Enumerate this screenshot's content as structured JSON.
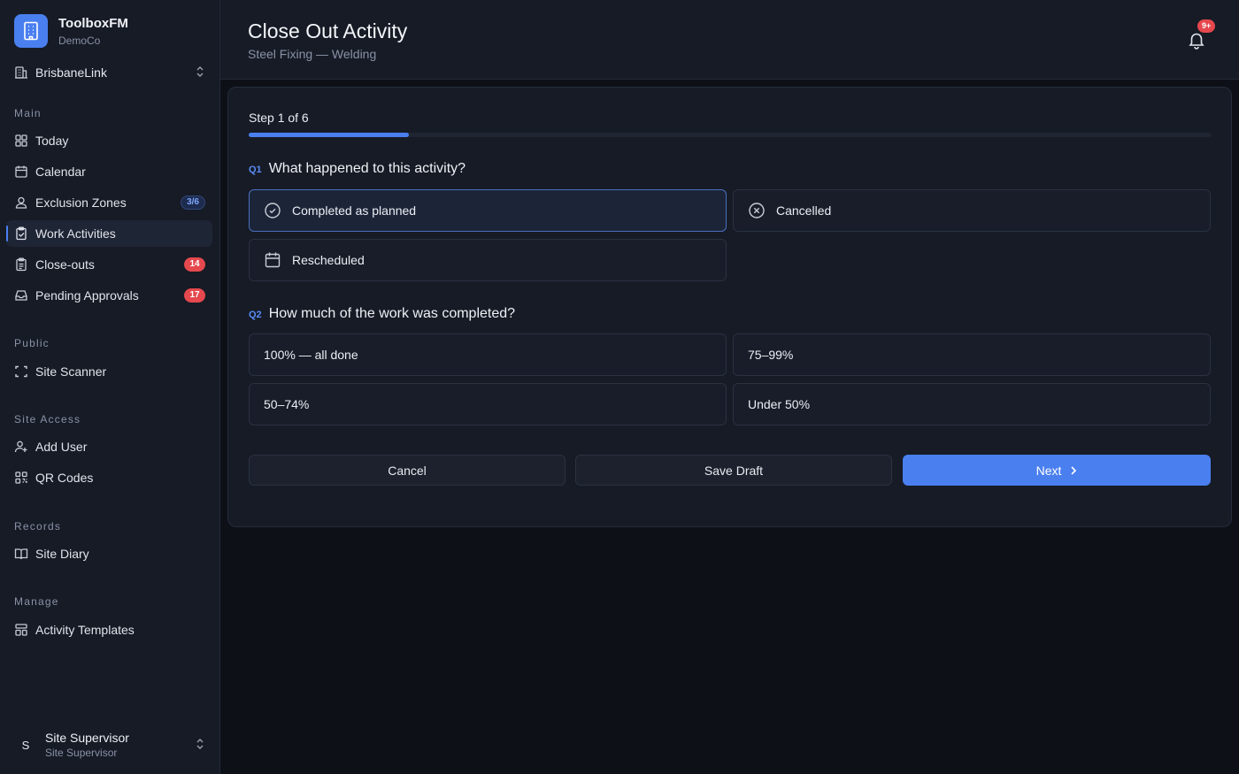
{
  "brand": {
    "name": "ToolboxFM",
    "org": "DemoCo"
  },
  "site": {
    "selected": "BrisbaneLink"
  },
  "sidebar": {
    "sections": {
      "main": "Main",
      "public": "Public",
      "site_access": "Site Access",
      "records": "Records",
      "manage": "Manage"
    },
    "items": {
      "today": "Today",
      "calendar": "Calendar",
      "exclusion_zones": "Exclusion Zones",
      "exclusion_badge": "3/6",
      "work_activities": "Work Activities",
      "close_outs": "Close-outs",
      "close_outs_badge": "14",
      "pending_approvals": "Pending Approvals",
      "pending_badge": "17",
      "site_scanner": "Site Scanner",
      "add_user": "Add User",
      "qr_codes": "QR Codes",
      "site_diary": "Site Diary",
      "activity_templates": "Activity Templates"
    },
    "active_item": "Work Activities"
  },
  "user": {
    "initial": "S",
    "name": "Site Supervisor",
    "role": "Site Supervisor"
  },
  "header": {
    "title": "Close Out Activity",
    "subtitle": "Steel Fixing — Welding",
    "notification_badge": "9+"
  },
  "wizard": {
    "step_label": "Step 1 of 6",
    "progress": 0.1667,
    "q1": {
      "num": "Q1",
      "text": "What happened to this activity?",
      "options": [
        "Completed as planned",
        "Cancelled",
        "Rescheduled"
      ],
      "selected": "Completed as planned"
    },
    "q2": {
      "num": "Q2",
      "text": "How much of the work was completed?",
      "options": [
        "100% — all done",
        "75–99%",
        "50–74%",
        "Under 50%"
      ]
    },
    "buttons": {
      "cancel": "Cancel",
      "save_draft": "Save Draft",
      "next": "Next"
    }
  },
  "colors": {
    "accent": "#4a7ff0",
    "danger": "#e5484d",
    "background": "#0d1017",
    "panel": "#161b26"
  }
}
